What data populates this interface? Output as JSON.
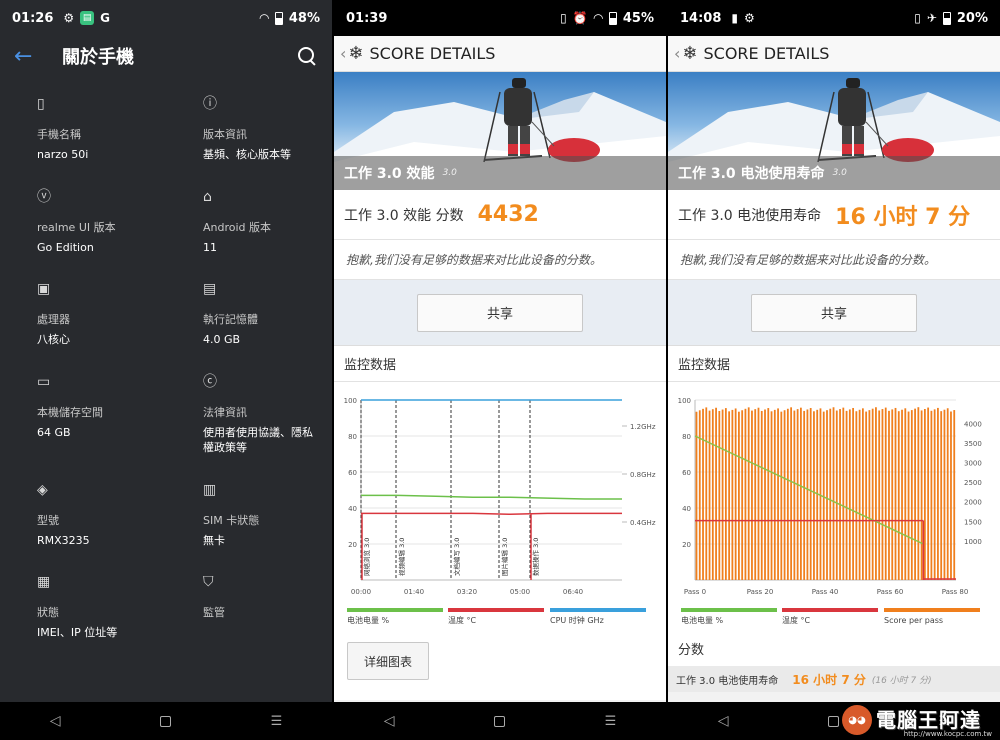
{
  "phone1": {
    "status": {
      "time": "01:26",
      "battery": "48%"
    },
    "title": "關於手機",
    "items": [
      {
        "icon": "phone-icon",
        "glyph": "▯",
        "label": "手機名稱",
        "value": "narzo 50i"
      },
      {
        "icon": "info-icon",
        "glyph": "ⓘ",
        "label": "版本資訊",
        "value": "基頻、核心版本等"
      },
      {
        "icon": "version-icon",
        "glyph": "ⓥ",
        "label": "realme UI 版本",
        "value": "Go Edition"
      },
      {
        "icon": "android-icon",
        "glyph": "🤖",
        "label": "Android 版本",
        "value": "11"
      },
      {
        "icon": "processor-icon",
        "glyph": "▣",
        "label": "處理器",
        "value": "八核心"
      },
      {
        "icon": "memory-icon",
        "glyph": "▤",
        "label": "執行記憶體",
        "value": "4.0 GB"
      },
      {
        "icon": "storage-icon",
        "glyph": "▭",
        "label": "本機儲存空間",
        "value": "64 GB"
      },
      {
        "icon": "copyright-icon",
        "glyph": "ⓒ",
        "label": "法律資訊",
        "value": "使用者使用協議、隱私權政策等"
      },
      {
        "icon": "layers-icon",
        "glyph": "◈",
        "label": "型號",
        "value": "RMX3235"
      },
      {
        "icon": "sim-icon",
        "glyph": "▥",
        "label": "SIM 卡狀態",
        "value": "無卡"
      },
      {
        "icon": "status-icon",
        "glyph": "▦",
        "label": "狀態",
        "value": "IMEI、IP 位址等"
      },
      {
        "icon": "shield-icon",
        "glyph": "⛉",
        "label": "監管",
        "value": ""
      }
    ]
  },
  "phone2": {
    "status": {
      "time": "01:39",
      "battery": "45%"
    },
    "header": "SCORE DETAILS",
    "hero_title": "工作 3.0 效能",
    "hero_version": "3.0",
    "score_label": "工作 3.0 效能 分数",
    "score_value": "4432",
    "sorry": "抱歉,我们没有足够的数据来对比此设备的分数。",
    "share": "共享",
    "monitor_title": "监控数据",
    "detail_button": "详细图表",
    "legend": [
      "电池电量 %",
      "温度 °C",
      "CPU 时钟 GHz"
    ]
  },
  "phone3": {
    "status": {
      "time": "14:08",
      "battery": "20%"
    },
    "header": "SCORE DETAILS",
    "hero_title": "工作 3.0 电池使用寿命",
    "hero_version": "3.0",
    "score_label": "工作 3.0 电池使用寿命",
    "score_value": "16 小时 7 分",
    "sorry": "抱歉,我们没有足够的数据来对比此设备的分数。",
    "share": "共享",
    "monitor_title": "监控数据",
    "score_section": "分数",
    "result_label": "工作 3.0 电池使用寿命",
    "result_value": "16 小时 7 分",
    "result_sub": "(16 小时 7 分)",
    "legend": [
      "电池电量 %",
      "温度 °C",
      "Score per pass"
    ]
  },
  "watermark": {
    "text": "電腦王阿達",
    "url": "http://www.kocpc.com.tw"
  },
  "colors": {
    "accent": "#f28c1e",
    "green": "#6cc04a",
    "red": "#d9363e",
    "blue": "#3aa0dc",
    "orange": "#f07f1d"
  },
  "chart_data": [
    {
      "type": "line",
      "x_ticks": [
        "00:00",
        "01:40",
        "03:20",
        "05:00",
        "06:40"
      ],
      "y_ticks_left": [
        20,
        40,
        60,
        80,
        100
      ],
      "y_ticks_right": [
        "0.4GHz",
        "0.8GHz",
        "1.2GHz"
      ],
      "ylim": [
        0,
        100
      ],
      "markers": [
        "网络浏览 3.0",
        "视频编辑 3.0",
        "文档编写 3.0",
        "图片编辑 3.0",
        "数据操作 3.0"
      ],
      "series": [
        {
          "name": "电池电量 %",
          "color": "#6cc04a",
          "values": [
            47,
            47,
            46.5,
            46,
            46,
            45.5,
            45,
            45
          ]
        },
        {
          "name": "温度 °C",
          "color": "#d9363e",
          "values": [
            37,
            37,
            37,
            37,
            36.5,
            37,
            37,
            37
          ]
        },
        {
          "name": "CPU 时钟 GHz",
          "color": "#3aa0dc",
          "values": [
            100,
            100,
            100,
            100,
            100,
            100,
            100,
            100
          ]
        }
      ]
    },
    {
      "type": "bar",
      "x_ticks": [
        "Pass 0",
        "Pass 20",
        "Pass 40",
        "Pass 60",
        "Pass 80"
      ],
      "y_ticks_left": [
        20,
        40,
        60,
        80,
        100
      ],
      "y_ticks_right": [
        1000,
        1500,
        2000,
        2500,
        3000,
        3500,
        4000
      ],
      "ylim": [
        0,
        100
      ],
      "series": [
        {
          "name": "电池电量 %",
          "color": "#6cc04a",
          "values": [
            80,
            20
          ]
        },
        {
          "name": "温度 °C",
          "color": "#d9363e",
          "values": [
            33,
            33
          ]
        },
        {
          "name": "Score per pass",
          "color": "#f07f1d",
          "pass_count": 80,
          "value_approx": 4400
        }
      ]
    }
  ]
}
